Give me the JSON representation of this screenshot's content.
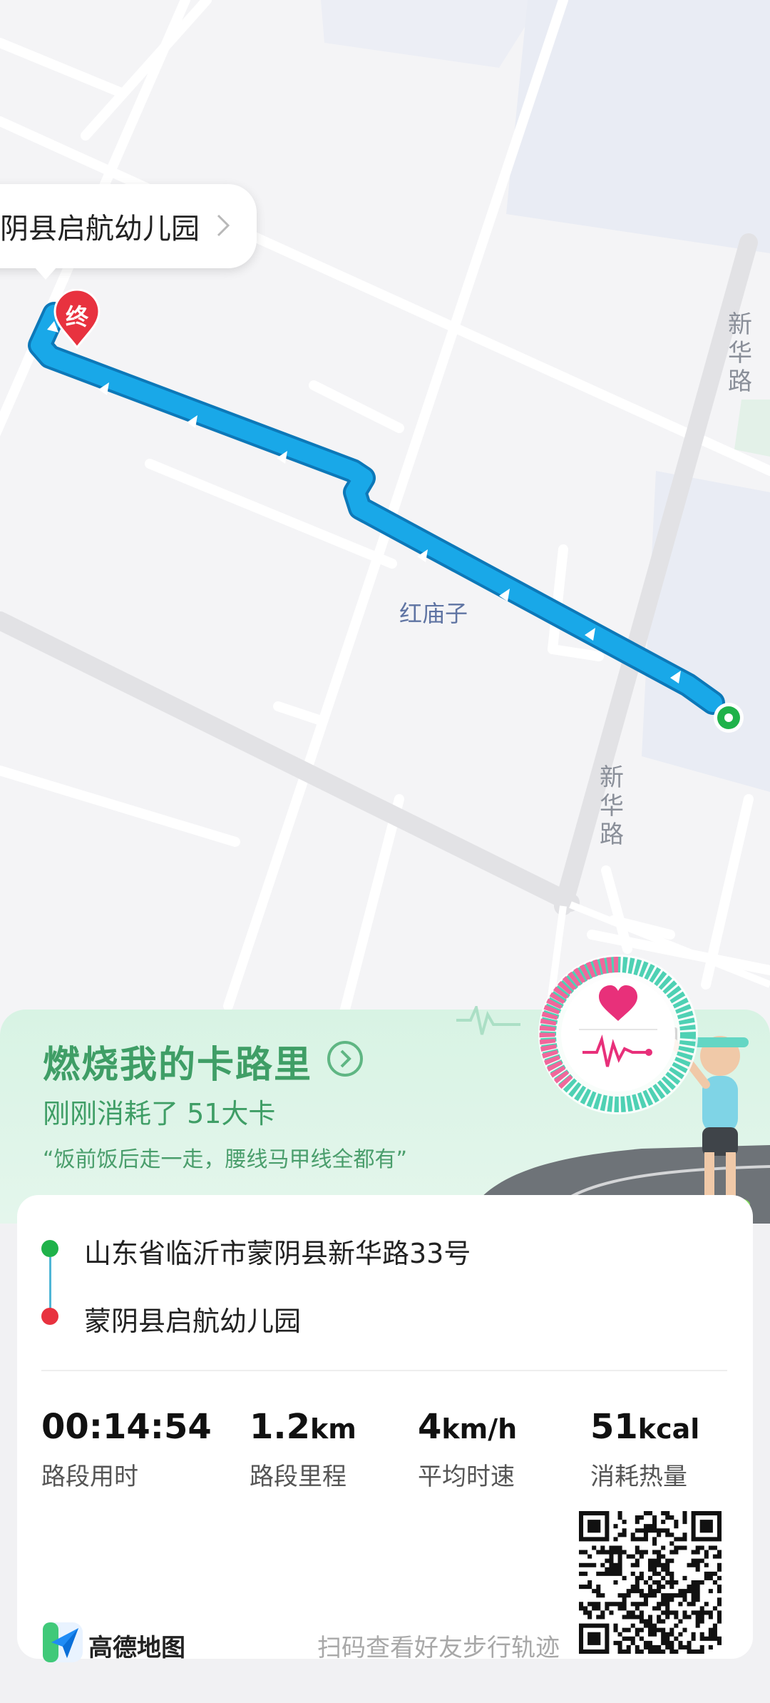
{
  "map": {
    "destination_name": "阴县启航幼儿园",
    "end_marker_label": "终",
    "road_labels": {
      "top": "新华路",
      "bottom": "新华路"
    },
    "place_label": "红庙子",
    "route_color": "#19a8e8",
    "start_color": "#1fb24a",
    "end_color": "#e8323f"
  },
  "promo": {
    "title": "燃烧我的卡路里",
    "subtitle": "刚刚消耗了 51大卡",
    "quote": "“饭前饭后走一走，腰线马甲线全都有”"
  },
  "trip": {
    "start_address": "山东省临沂市蒙阴县新华路33号",
    "end_address": "蒙阴县启航幼儿园",
    "stats": [
      {
        "value": "00:14:54",
        "unit": "",
        "label": "路段用时"
      },
      {
        "value": "1.2",
        "unit": "km",
        "label": "路段里程"
      },
      {
        "value": "4",
        "unit": "km/h",
        "label": "平均时速"
      },
      {
        "value": "51",
        "unit": "kcal",
        "label": "消耗热量"
      }
    ]
  },
  "footer": {
    "logo_text": "高德地图",
    "scan_hint": "扫码查看好友步行轨迹",
    "logo_icon": "amap-logo-icon",
    "qr_icon": "qr-code-icon"
  }
}
